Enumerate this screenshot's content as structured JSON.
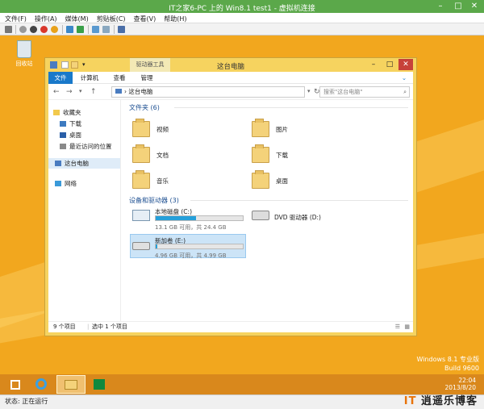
{
  "host": {
    "title": "IT之家6-PC 上的 Win8.1 test1 - 虚拟机连接",
    "menu": [
      "文件(F)",
      "操作(A)",
      "媒体(M)",
      "剪贴板(C)",
      "查看(V)",
      "帮助(H)"
    ],
    "status": "状态: 正在运行",
    "brand_color": "#5ba84a"
  },
  "desktop": {
    "recycle_label": "回收站",
    "watermark_line1": "Windows 8.1 专业版",
    "watermark_line2": "Build 9600",
    "bg_color": "#f2a71e"
  },
  "explorer": {
    "context_tab": "驱动器工具",
    "window_title": "这台电脑",
    "tabs": [
      "文件",
      "计算机",
      "查看",
      "管理"
    ],
    "address": "这台电脑",
    "search_placeholder": "搜索\"这台电脑\"",
    "sidebar": [
      "收藏夹",
      "下载",
      "桌面",
      "最近访问的位置",
      "这台电脑",
      "网络"
    ],
    "folders_header": "文件夹 (6)",
    "folders": [
      "视频",
      "图片",
      "文档",
      "下载",
      "音乐",
      "桌面"
    ],
    "drives_header": "设备和驱动器 (3)",
    "drives": [
      {
        "name": "本地磁盘 (C:)",
        "free": "13.1 GB 可用，共 24.4 GB",
        "used_fraction": 0.46
      },
      {
        "name": "DVD 驱动器 (D:)"
      },
      {
        "name": "新加卷 (E:)",
        "free": "4.96 GB 可用，共 4.99 GB",
        "used_fraction": 0.01
      }
    ],
    "status_items": "9 个项目",
    "status_selected": "选中 1 个项目",
    "accent_color": "#1979ca"
  },
  "taskbar": {
    "time": "22:04",
    "date": "2013/8/20"
  },
  "blog": {
    "prefix": "IT",
    "name": "逍遥乐博客"
  }
}
